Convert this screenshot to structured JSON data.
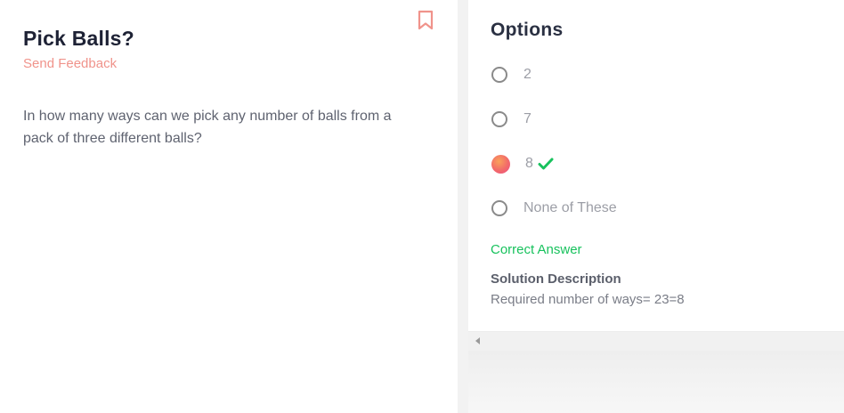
{
  "question": {
    "title": "Pick Balls?",
    "feedback_label": "Send Feedback",
    "text": "In how many ways can we pick any number of balls from a pack of three different balls?"
  },
  "options_panel": {
    "heading": "Options",
    "options": [
      {
        "label": "2",
        "selected": false
      },
      {
        "label": "7",
        "selected": false
      },
      {
        "label": "8",
        "selected": true,
        "correct": true
      },
      {
        "label": "None of These",
        "selected": false
      }
    ],
    "result_label": "Correct Answer",
    "solution_heading": "Solution Description",
    "solution_text": "Required number of ways= 23=8"
  },
  "icons": {
    "bookmark": "bookmark-icon",
    "check": "checkmark-icon"
  },
  "colors": {
    "accent": "#f0938b",
    "correct": "#18c25d",
    "title": "#1e2235"
  }
}
